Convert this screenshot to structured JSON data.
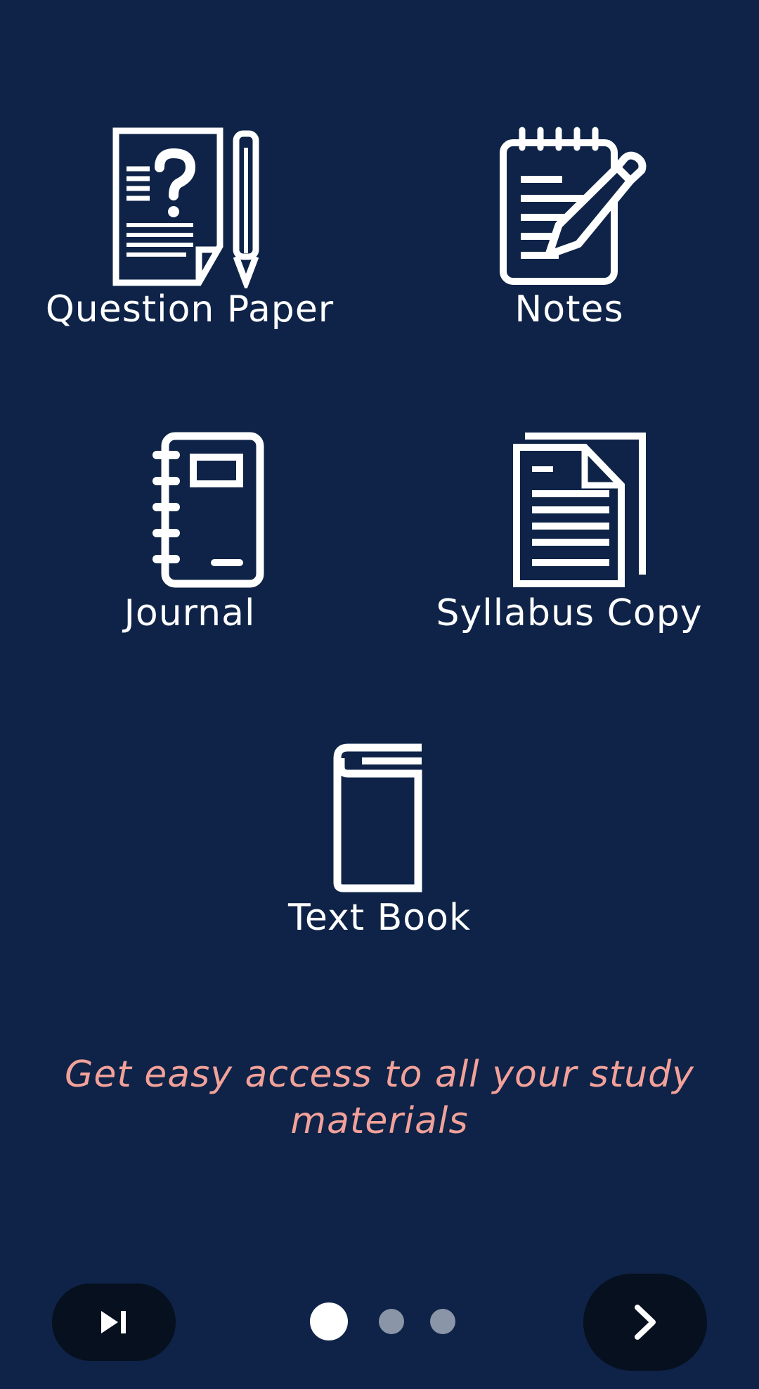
{
  "categories": [
    {
      "label": "Question Paper",
      "icon": "question-paper-icon"
    },
    {
      "label": "Notes",
      "icon": "notes-icon"
    },
    {
      "label": "Journal",
      "icon": "journal-icon"
    },
    {
      "label": "Syllabus Copy",
      "icon": "syllabus-copy-icon"
    },
    {
      "label": "Text Book",
      "icon": "text-book-icon"
    }
  ],
  "tagline": "Get easy access to all your study materials",
  "pager": {
    "current_page": 1,
    "total_pages": 3
  },
  "controls": {
    "skip_icon": "skip-next-icon",
    "next_icon": "chevron-right-icon"
  },
  "colors": {
    "background": "#0e2347",
    "tagline": "#f2a19a",
    "button": "#06101f",
    "dot_active": "#ffffff",
    "dot_inactive": "#8a95a8"
  }
}
